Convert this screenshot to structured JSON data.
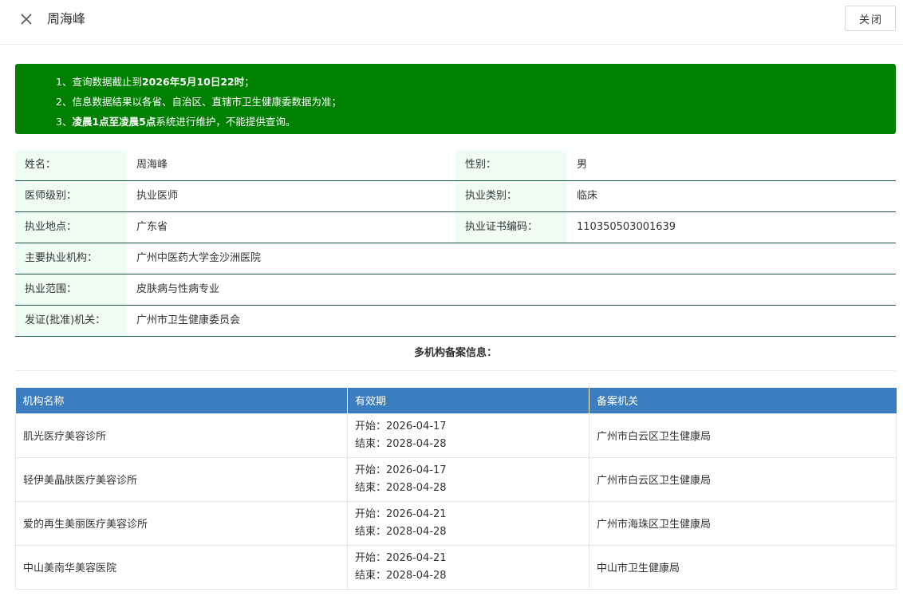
{
  "header": {
    "title": "周海峰",
    "close_button": "关闭",
    "close_icon": "close-icon"
  },
  "notice": {
    "line1_prefix": "1、查询数据截止到",
    "line1_bold": "2026年5月10日22时",
    "line1_suffix": "；",
    "line2": "2、信息数据结果以各省、自治区、直辖市卫生健康委数据为准；",
    "line3_prefix": "3、",
    "line3_bold": "凌晨1点至凌晨5点",
    "line3_suffix": "系统进行维护，不能提供查询。"
  },
  "info": {
    "name_label": "姓名：",
    "name_value": "周海峰",
    "gender_label": "性别：",
    "gender_value": "男",
    "level_label": "医师级别：",
    "level_value": "执业医师",
    "category_label": "执业类别：",
    "category_value": "临床",
    "location_label": "执业地点：",
    "location_value": "广东省",
    "cert_label": "执业证书编码：",
    "cert_value": "110350503001639",
    "institution_label": "主要执业机构：",
    "institution_value": "广州中医药大学金沙洲医院",
    "scope_label": "执业范围：",
    "scope_value": "皮肤病与性病专业",
    "authority_label": "发证(批准)机关：",
    "authority_value": "广州市卫生健康委员会"
  },
  "multi": {
    "title": "多机构备案信息：",
    "columns": [
      "机构名称",
      "有效期",
      "备案机关"
    ],
    "rows": [
      {
        "name": "肌光医疗美容诊所",
        "start": "开始：2026-04-17",
        "end": "结束：2028-04-28",
        "org": "广州市白云区卫生健康局"
      },
      {
        "name": "轻伊美晶肤医疗美容诊所",
        "start": "开始：2026-04-17",
        "end": "结束：2028-04-28",
        "org": "广州市白云区卫生健康局"
      },
      {
        "name": "爱的再生美丽医疗美容诊所",
        "start": "开始：2026-04-21",
        "end": "结束：2028-04-28",
        "org": "广州市海珠区卫生健康局"
      },
      {
        "name": "中山美南华美容医院",
        "start": "开始：2026-04-21",
        "end": "结束：2028-04-28",
        "org": "中山市卫生健康局"
      }
    ]
  },
  "colors": {
    "notice_bg": "#008000",
    "label_bg": "#effdf5",
    "row_border": "#1c5747",
    "table_header": "#3a7ebf"
  }
}
